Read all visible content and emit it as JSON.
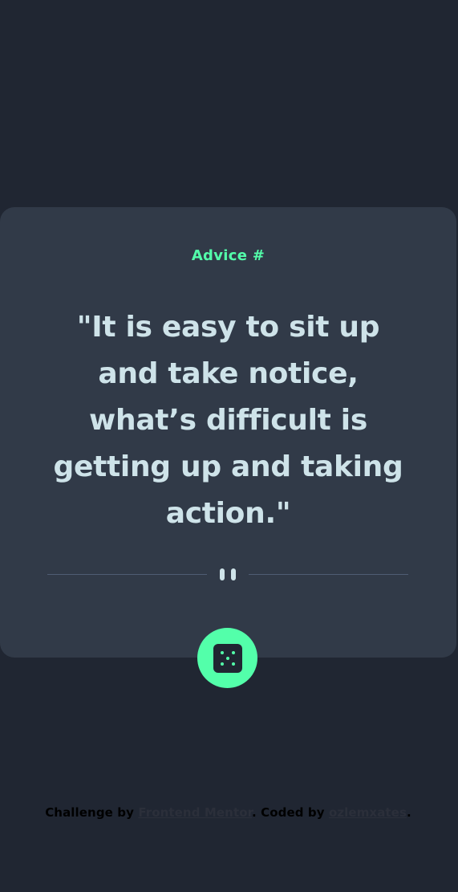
{
  "colors": {
    "background": "#202632",
    "card": "#313a48",
    "accent": "#53ffaa",
    "quote_text": "#cee3e9",
    "divider": "#4f5d74"
  },
  "card": {
    "advice_label": "Advice #",
    "quote": "\"It is easy to sit up and take notice, what’s difficult is getting up and taking action.\""
  },
  "divider": {
    "icon": "pause-icon"
  },
  "dice_button": {
    "icon": "dice-icon"
  },
  "footer": {
    "prefix": "Challenge by ",
    "challenge_link": "Frontend Mentor",
    "middle": ". Coded by ",
    "author_link": "ozlemxates",
    "suffix": "."
  }
}
